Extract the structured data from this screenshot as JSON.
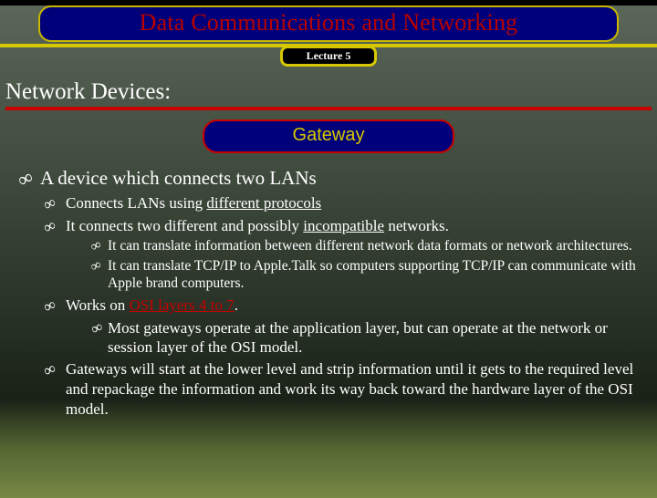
{
  "header": {
    "title": "Data Communications and Networking",
    "lecture": "Lecture 5"
  },
  "section": "Network Devices:",
  "subsection": "Gateway",
  "points": {
    "p1": "A device which connects two LANs",
    "p2a": "Connects LANs using ",
    "p2b": "different protocols",
    "p3a": "It connects two different and possibly ",
    "p3b": "incompatible",
    "p3c": " networks.",
    "p4": "It can translate information between different network data formats or network architectures.",
    "p5": "It can translate TCP/IP to Apple.Talk so computers supporting TCP/IP can communicate with Apple brand computers.",
    "p6a": "Works on ",
    "p6b": "OSI layers 4 to 7",
    "p6c": ".",
    "p7": "Most gateways operate at the application layer, but can operate at the network or session layer of the OSI model.",
    "p8": "Gateways will start at the lower level and strip information until it gets to the required level and repackage the information and work its way back toward the hardware layer of the OSI model."
  }
}
